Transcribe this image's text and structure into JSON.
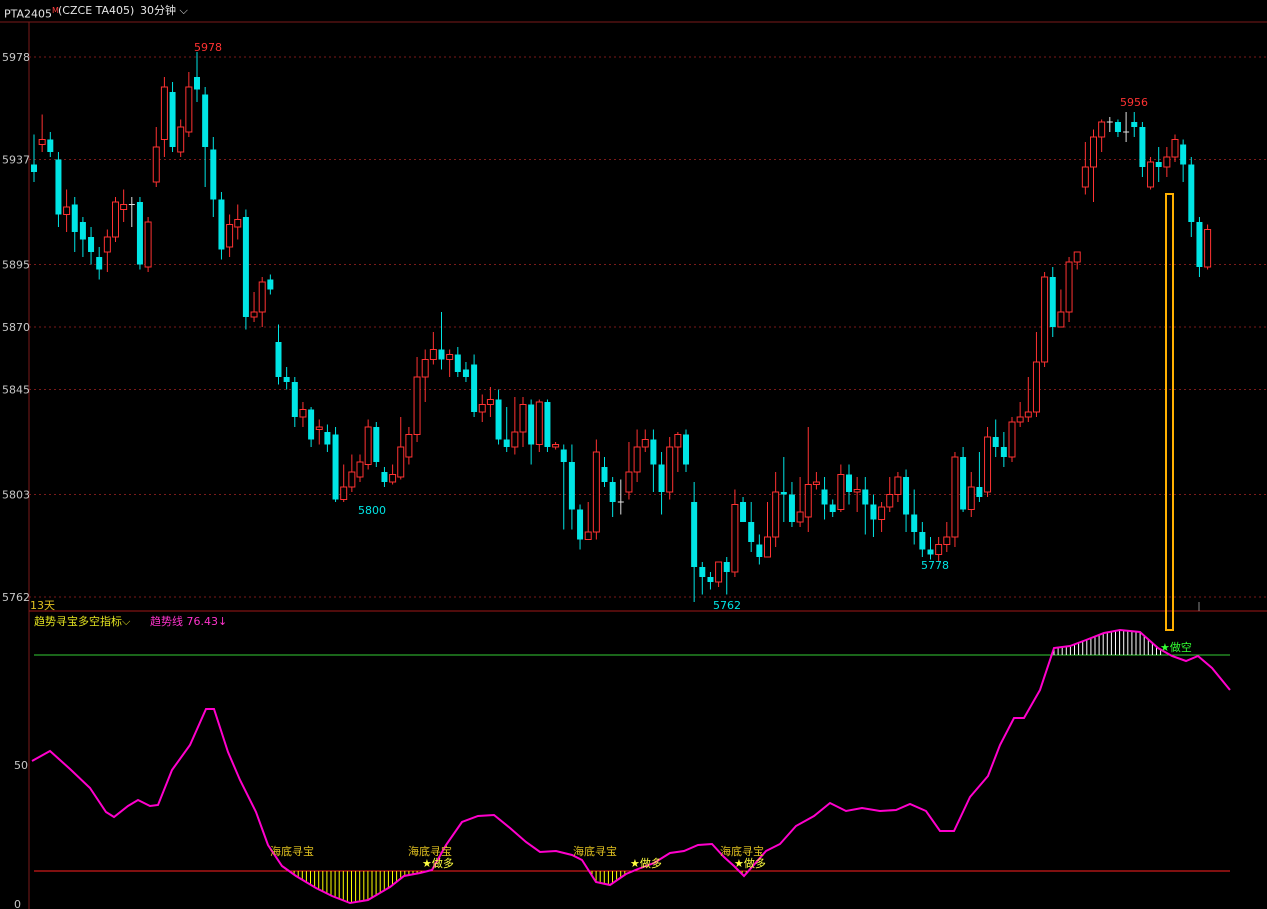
{
  "header": {
    "symbol": "PTA2405",
    "symbol_mark": "M",
    "code": "(CZCE  TA405)",
    "period": "30分钟",
    "period_arrow": "⌵"
  },
  "colors": {
    "up": "#ff3232",
    "down": "#00e5e5",
    "grid": "#7a1a1a",
    "trend_line": "#ff00cc",
    "upper_line": "#33cc33",
    "lower_line": "#ff2020",
    "buy_fill": "#ffff00",
    "sell_fill": "#ffffff",
    "signal_box": "#ffb000"
  },
  "price_axis": {
    "ticks": [
      "5978",
      "5937",
      "5895",
      "5870",
      "5845",
      "5803",
      "5762"
    ]
  },
  "indicator_axis": {
    "ticks": [
      "50",
      "0"
    ]
  },
  "days_label": "13天",
  "indicator": {
    "title": "趋势寻宝多空指标",
    "dropdown_icon": "⌵",
    "trend_label": "趋势线",
    "trend_value": "76.43",
    "trend_arrow": "↓"
  },
  "price_annotations": [
    {
      "text": "5978",
      "kind": "high"
    },
    {
      "text": "5800",
      "kind": "low"
    },
    {
      "text": "5762",
      "kind": "low"
    },
    {
      "text": "5778",
      "kind": "low"
    },
    {
      "text": "5956",
      "kind": "high"
    }
  ],
  "signals": [
    {
      "text": "海底寻宝",
      "kind": "zone"
    },
    {
      "text": "海底寻宝",
      "kind": "zone"
    },
    {
      "text": "★做多",
      "kind": "buy"
    },
    {
      "text": "海底寻宝",
      "kind": "zone"
    },
    {
      "text": "★做多",
      "kind": "buy"
    },
    {
      "text": "海底寻宝",
      "kind": "zone"
    },
    {
      "text": "★做多",
      "kind": "buy"
    },
    {
      "text": "★做空",
      "kind": "sell"
    }
  ],
  "chart_data": {
    "type": "candlestick",
    "price_range": [
      5755,
      5985
    ],
    "indicator_range": [
      0,
      100
    ],
    "candles": [
      [
        5935,
        5932,
        5947,
        5928
      ],
      [
        5943,
        5945,
        5955,
        5940
      ],
      [
        5945,
        5940,
        5948,
        5938
      ],
      [
        5937,
        5915,
        5940,
        5910
      ],
      [
        5915,
        5918,
        5925,
        5908
      ],
      [
        5919,
        5908,
        5922,
        5900
      ],
      [
        5912,
        5905,
        5914,
        5898
      ],
      [
        5906,
        5900,
        5910,
        5895
      ],
      [
        5898,
        5893,
        5902,
        5889
      ],
      [
        5900,
        5906,
        5909,
        5892
      ],
      [
        5906,
        5920,
        5922,
        5904
      ],
      [
        5917,
        5919,
        5925,
        5912
      ],
      [
        5919,
        5919,
        5922,
        5910
      ],
      [
        5920,
        5895,
        5922,
        5893
      ],
      [
        5894,
        5912,
        5914,
        5892
      ],
      [
        5928,
        5942,
        5950,
        5926
      ],
      [
        5945,
        5966,
        5970,
        5938
      ],
      [
        5964,
        5942,
        5968,
        5940
      ],
      [
        5940,
        5950,
        5953,
        5938
      ],
      [
        5948,
        5966,
        5972,
        5946
      ],
      [
        5970,
        5965,
        5980,
        5960
      ],
      [
        5963,
        5942,
        5966,
        5926
      ],
      [
        5941,
        5921,
        5946,
        5914
      ],
      [
        5921,
        5901,
        5924,
        5897
      ],
      [
        5902,
        5911,
        5915,
        5898
      ],
      [
        5910,
        5913,
        5919,
        5905
      ],
      [
        5914,
        5874,
        5917,
        5869
      ],
      [
        5874,
        5876,
        5884,
        5872
      ],
      [
        5876,
        5888,
        5890,
        5870
      ],
      [
        5889,
        5885,
        5891,
        5883
      ],
      [
        5864,
        5850,
        5871,
        5847
      ],
      [
        5850,
        5848,
        5854,
        5845
      ],
      [
        5848,
        5834,
        5850,
        5830
      ],
      [
        5834,
        5837,
        5840,
        5830
      ],
      [
        5837,
        5825,
        5838,
        5822
      ],
      [
        5829,
        5830,
        5833,
        5823
      ],
      [
        5828,
        5823,
        5831,
        5820
      ],
      [
        5827,
        5801,
        5830,
        5800
      ],
      [
        5801,
        5806,
        5815,
        5800
      ],
      [
        5806,
        5812,
        5819,
        5804
      ],
      [
        5810,
        5816,
        5819,
        5808
      ],
      [
        5815,
        5830,
        5833,
        5813
      ],
      [
        5830,
        5816,
        5832,
        5814
      ],
      [
        5812,
        5808,
        5814,
        5806
      ],
      [
        5808,
        5811,
        5815,
        5807
      ],
      [
        5810,
        5822,
        5834,
        5809
      ],
      [
        5818,
        5827,
        5830,
        5815
      ],
      [
        5827,
        5850,
        5858,
        5824
      ],
      [
        5850,
        5857,
        5861,
        5840
      ],
      [
        5857,
        5861,
        5868,
        5855
      ],
      [
        5861,
        5857,
        5876,
        5853
      ],
      [
        5857,
        5859,
        5861,
        5850
      ],
      [
        5859,
        5852,
        5862,
        5850
      ],
      [
        5853,
        5850,
        5856,
        5848
      ],
      [
        5855,
        5836,
        5859,
        5834
      ],
      [
        5836,
        5839,
        5843,
        5832
      ],
      [
        5839,
        5841,
        5846,
        5834
      ],
      [
        5841,
        5825,
        5845,
        5823
      ],
      [
        5825,
        5822,
        5838,
        5820
      ],
      [
        5822,
        5828,
        5842,
        5819
      ],
      [
        5828,
        5839,
        5842,
        5822
      ],
      [
        5839,
        5823,
        5841,
        5815
      ],
      [
        5823,
        5840,
        5841,
        5820
      ],
      [
        5840,
        5822,
        5841,
        5820
      ],
      [
        5822,
        5823,
        5824,
        5821
      ],
      [
        5821,
        5816,
        5823,
        5789
      ],
      [
        5816,
        5797,
        5823,
        5789
      ],
      [
        5797,
        5785,
        5799,
        5781
      ],
      [
        5785,
        5788,
        5800,
        5785
      ],
      [
        5788,
        5820,
        5825,
        5785
      ],
      [
        5814,
        5808,
        5818,
        5806
      ],
      [
        5808,
        5800,
        5810,
        5794
      ],
      [
        5800,
        5800,
        5809,
        5795
      ],
      [
        5804,
        5812,
        5824,
        5801
      ],
      [
        5812,
        5822,
        5829,
        5808
      ],
      [
        5822,
        5825,
        5829,
        5820
      ],
      [
        5825,
        5815,
        5829,
        5804
      ],
      [
        5815,
        5804,
        5820,
        5795
      ],
      [
        5804,
        5822,
        5826,
        5801
      ],
      [
        5822,
        5827,
        5828,
        5812
      ],
      [
        5827,
        5815,
        5829,
        5812
      ],
      [
        5800,
        5774,
        5808,
        5760
      ],
      [
        5774,
        5770,
        5776,
        5763
      ],
      [
        5770,
        5768,
        5772,
        5765
      ],
      [
        5768,
        5776,
        5774,
        5766
      ],
      [
        5776,
        5772,
        5778,
        5763
      ],
      [
        5772,
        5799,
        5805,
        5770
      ],
      [
        5800,
        5792,
        5802,
        5792
      ],
      [
        5792,
        5784,
        5800,
        5780
      ],
      [
        5783,
        5778,
        5787,
        5775
      ],
      [
        5778,
        5786,
        5800,
        5780
      ],
      [
        5786,
        5804,
        5812,
        5782
      ],
      [
        5804,
        5803,
        5818,
        5792
      ],
      [
        5803,
        5792,
        5808,
        5790
      ],
      [
        5792,
        5796,
        5810,
        5790
      ],
      [
        5794,
        5807,
        5830,
        5788
      ],
      [
        5807,
        5808,
        5812,
        5805
      ],
      [
        5805,
        5799,
        5810,
        5793
      ],
      [
        5799,
        5796,
        5801,
        5794
      ],
      [
        5797,
        5811,
        5815,
        5796
      ],
      [
        5811,
        5804,
        5815,
        5799
      ],
      [
        5804,
        5805,
        5810,
        5796
      ],
      [
        5805,
        5799,
        5810,
        5787
      ],
      [
        5799,
        5793,
        5803,
        5786
      ],
      [
        5793,
        5798,
        5800,
        5788
      ],
      [
        5798,
        5803,
        5810,
        5796
      ],
      [
        5803,
        5810,
        5812,
        5800
      ],
      [
        5810,
        5795,
        5813,
        5788
      ],
      [
        5795,
        5788,
        5805,
        5783
      ],
      [
        5788,
        5781,
        5792,
        5778
      ],
      [
        5781,
        5779,
        5786,
        5777
      ],
      [
        5779,
        5783,
        5786,
        5776
      ],
      [
        5783,
        5786,
        5792,
        5780
      ],
      [
        5786,
        5818,
        5820,
        5782
      ],
      [
        5818,
        5797,
        5822,
        5796
      ],
      [
        5797,
        5806,
        5812,
        5794
      ],
      [
        5806,
        5802,
        5820,
        5800
      ],
      [
        5804,
        5826,
        5830,
        5802
      ],
      [
        5826,
        5822,
        5833,
        5818
      ],
      [
        5822,
        5818,
        5828,
        5814
      ],
      [
        5818,
        5832,
        5834,
        5816
      ],
      [
        5832,
        5834,
        5840,
        5830
      ],
      [
        5834,
        5836,
        5850,
        5832
      ],
      [
        5836,
        5856,
        5868,
        5834
      ],
      [
        5856,
        5890,
        5892,
        5854
      ],
      [
        5890,
        5870,
        5894,
        5866
      ],
      [
        5870,
        5876,
        5885,
        5870
      ],
      [
        5876,
        5896,
        5898,
        5872
      ],
      [
        5896,
        5900,
        5900,
        5893
      ],
      [
        5926,
        5934,
        5944,
        5923
      ],
      [
        5934,
        5946,
        5949,
        5920
      ],
      [
        5946,
        5952,
        5953,
        5940
      ],
      [
        5952,
        5952,
        5954,
        5948
      ],
      [
        5952,
        5948,
        5953,
        5946
      ],
      [
        5948,
        5948,
        5956,
        5944
      ],
      [
        5952,
        5950,
        5956,
        5946
      ],
      [
        5950,
        5934,
        5952,
        5930
      ],
      [
        5926,
        5936,
        5938,
        5925
      ],
      [
        5936,
        5934,
        5942,
        5928
      ],
      [
        5934,
        5938,
        5942,
        5930
      ],
      [
        5938,
        5945,
        5947,
        5936
      ],
      [
        5943,
        5935,
        5945,
        5928
      ],
      [
        5935,
        5912,
        5938,
        5906
      ],
      [
        5912,
        5894,
        5914,
        5890
      ],
      [
        5894,
        5909,
        5911,
        5893
      ]
    ],
    "trend_line": [
      [
        32,
        51
      ],
      [
        50,
        54
      ],
      [
        70,
        45
      ],
      [
        90,
        36
      ],
      [
        110,
        29
      ],
      [
        130,
        32
      ],
      [
        150,
        38
      ],
      [
        160,
        36
      ],
      [
        170,
        43
      ],
      [
        190,
        58
      ],
      [
        205,
        72
      ],
      [
        215,
        72
      ],
      [
        230,
        48
      ],
      [
        250,
        22
      ],
      [
        265,
        5
      ],
      [
        280,
        0
      ]
    ]
  }
}
